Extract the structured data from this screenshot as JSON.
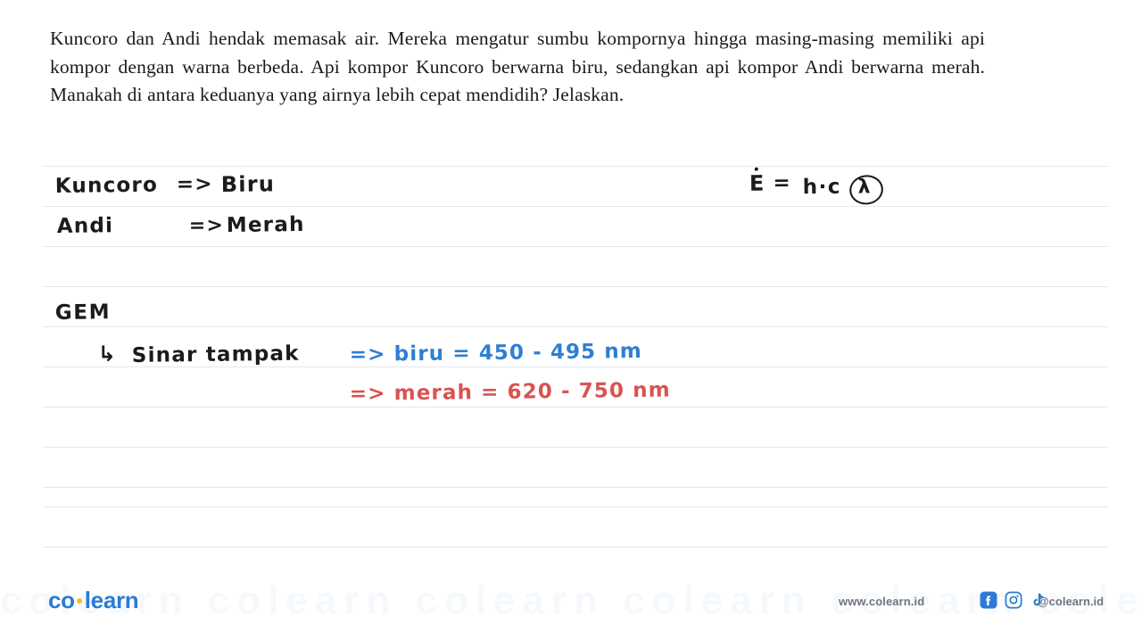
{
  "question": {
    "text": "Kuncoro dan Andi hendak memasak air. Mereka mengatur sumbu kompornya hingga masing-masing memiliki api kompor dengan warna berbeda. Api kompor Kuncoro berwarna biru, sedangkan api kompor Andi berwarna merah. Manakah di antara keduanya yang airnya lebih cepat mendidih? Jelaskan."
  },
  "annotations": {
    "line1_subject": "Kuncoro",
    "line1_arrow": "=>",
    "line1_value": "Biru",
    "line2_subject": "Andi",
    "line2_arrow": "=>",
    "line2_value": "Merah",
    "gem_label": "GEM",
    "gem_hook": "↳",
    "gem_child": "Sinar tampak",
    "blue_note": "=> biru = 450 - 495 nm",
    "red_note": "=> merah = 620 - 750 nm",
    "blue_color": "#2f7fd1",
    "red_color": "#d9534f"
  },
  "formula": {
    "energy_symbol": "E",
    "equals": "=",
    "numerator": "h·c",
    "denominator": "λ"
  },
  "footer": {
    "logo_left": "co",
    "logo_right": "learn",
    "site_url": "www.colearn.id",
    "handle": "@colearn.id",
    "watermark_text": "colearn colearn colearn colearn colearn colearn colearn",
    "brand_color": "#2b7bd4",
    "logo_dot_color": "#f3c01c"
  }
}
